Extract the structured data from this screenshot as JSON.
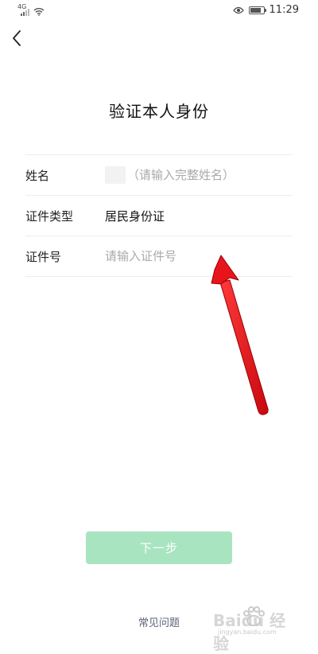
{
  "status_bar": {
    "network": "4G",
    "time": "11:29"
  },
  "page": {
    "title": "验证本人身份"
  },
  "form": {
    "name_label": "姓名",
    "name_placeholder": "（请输入完整姓名）",
    "id_type_label": "证件类型",
    "id_type_value": "居民身份证",
    "id_number_label": "证件号",
    "id_number_placeholder": "请输入证件号"
  },
  "actions": {
    "next_label": "下一步",
    "faq_label": "常见问题"
  },
  "watermark": {
    "brand": "Baidu 经验",
    "url": "jingyan.baidu.com"
  },
  "colors": {
    "button_disabled": "#a8e4c0",
    "annotation_arrow": "#e8141c",
    "faq_text": "#5b6478"
  }
}
